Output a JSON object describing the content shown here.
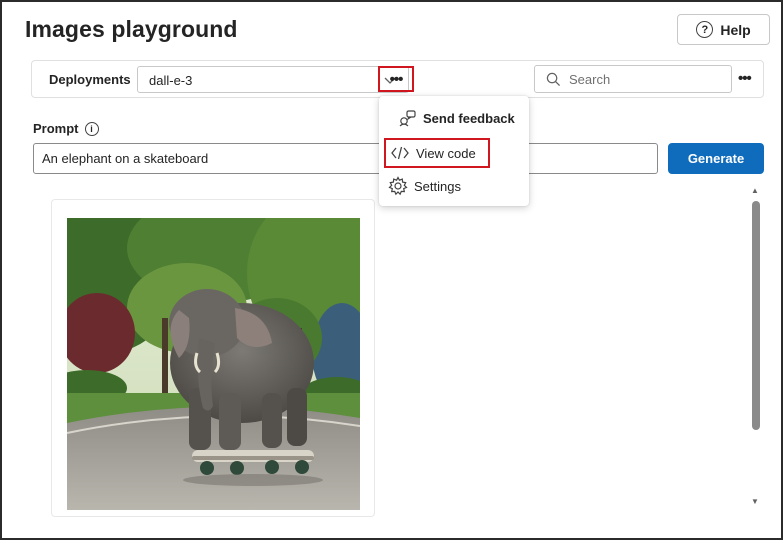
{
  "page": {
    "title": "Images playground"
  },
  "header": {
    "help_label": "Help"
  },
  "toolbar": {
    "deployments_label": "Deployments",
    "deployment_value": "dall-e-3",
    "search_placeholder": "Search"
  },
  "menu": {
    "items": [
      {
        "label": "Send feedback",
        "icon": "feedback-icon"
      },
      {
        "label": "View code",
        "icon": "code-icon"
      },
      {
        "label": "Settings",
        "icon": "gear-icon"
      }
    ]
  },
  "prompt": {
    "label": "Prompt",
    "value": "An elephant on a skateboard"
  },
  "actions": {
    "generate_label": "Generate"
  },
  "colors": {
    "accent": "#0f6cbd",
    "highlight": "#d0161e"
  }
}
